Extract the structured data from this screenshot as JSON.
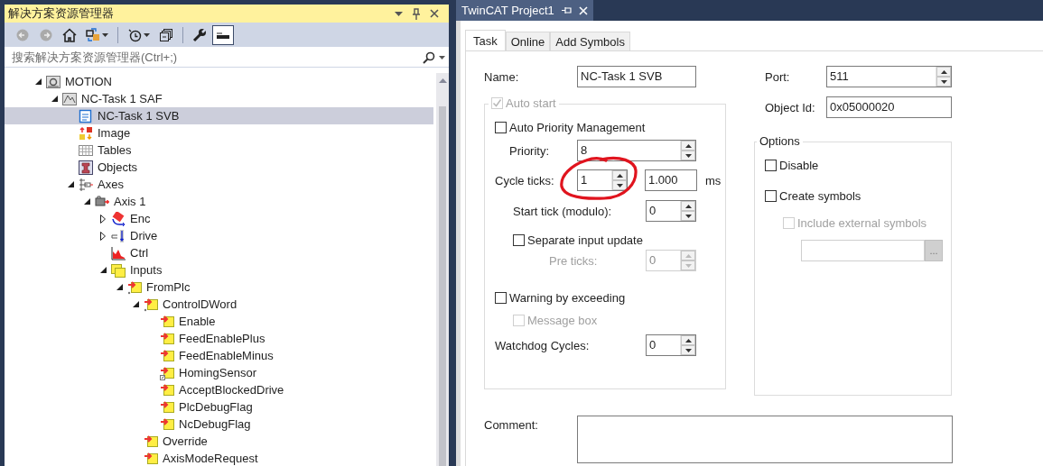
{
  "explorer": {
    "title": "解决方案资源管理器",
    "toolbar": [
      {
        "kind": "back",
        "disabled": true,
        "pressed": false
      },
      {
        "kind": "forward",
        "disabled": true,
        "pressed": false
      },
      {
        "kind": "home",
        "disabled": false,
        "pressed": false
      },
      {
        "kind": "sync",
        "disabled": false,
        "pressed": false
      },
      {
        "kind": "history",
        "disabled": false,
        "pressed": false
      },
      {
        "kind": "collapse",
        "disabled": false,
        "pressed": false
      },
      {
        "kind": "properties",
        "disabled": false,
        "pressed": false
      },
      {
        "kind": "preview",
        "disabled": false,
        "pressed": true
      }
    ],
    "search": {
      "placeholder": "搜索解决方案资源管理器(Ctrl+;)"
    },
    "tree": [
      {
        "label": "MOTION",
        "kind": "motion",
        "selected": false,
        "expanded": true,
        "children": [
          {
            "label": "NC-Task 1 SAF",
            "kind": "task",
            "selected": false,
            "expanded": true,
            "children": [
              {
                "label": "NC-Task 1 SVB",
                "kind": "task-svb",
                "selected": true
              },
              {
                "label": "Image",
                "kind": "image",
                "selected": false
              },
              {
                "label": "Tables",
                "kind": "tables",
                "selected": false
              },
              {
                "label": "Objects",
                "kind": "objects",
                "selected": false
              },
              {
                "label": "Axes",
                "kind": "axes",
                "selected": false,
                "expanded": true,
                "children": [
                  {
                    "label": "Axis 1",
                    "kind": "axis",
                    "selected": false,
                    "expanded": true,
                    "children": [
                      {
                        "label": "Enc",
                        "kind": "enc",
                        "selected": false,
                        "expanded": false
                      },
                      {
                        "label": "Drive",
                        "kind": "drive",
                        "selected": false,
                        "expanded": false
                      },
                      {
                        "label": "Ctrl",
                        "kind": "ctrl",
                        "selected": false
                      },
                      {
                        "label": "Inputs",
                        "kind": "inputs",
                        "selected": false,
                        "expanded": true,
                        "children": [
                          {
                            "label": "FromPlc",
                            "kind": "var-struct",
                            "selected": false,
                            "expanded": true,
                            "children": [
                              {
                                "label": "ControlDWord",
                                "kind": "var-struct",
                                "selected": false,
                                "expanded": true,
                                "children": [
                                  {
                                    "label": "Enable",
                                    "kind": "var",
                                    "selected": false
                                  },
                                  {
                                    "label": "FeedEnablePlus",
                                    "kind": "var",
                                    "selected": false
                                  },
                                  {
                                    "label": "FeedEnableMinus",
                                    "kind": "var",
                                    "selected": false
                                  },
                                  {
                                    "label": "HomingSensor",
                                    "kind": "var-linked",
                                    "selected": false
                                  },
                                  {
                                    "label": "AcceptBlockedDrive",
                                    "kind": "var",
                                    "selected": false
                                  },
                                  {
                                    "label": "PlcDebugFlag",
                                    "kind": "var",
                                    "selected": false
                                  },
                                  {
                                    "label": "NcDebugFlag",
                                    "kind": "var",
                                    "selected": false
                                  }
                                ]
                              },
                              {
                                "label": "Override",
                                "kind": "var",
                                "selected": false
                              },
                              {
                                "label": "AxisModeRequest",
                                "kind": "var",
                                "selected": false
                              }
                            ]
                          }
                        ]
                      }
                    ]
                  }
                ]
              }
            ]
          }
        ]
      }
    ]
  },
  "document_tab": {
    "title": "TwinCAT Project1"
  },
  "tabs": [
    {
      "label": "Task",
      "selected": true
    },
    {
      "label": "Online",
      "selected": false
    },
    {
      "label": "Add Symbols",
      "selected": false
    }
  ],
  "form": {
    "name": {
      "label": "Name:",
      "value": "NC-Task 1 SVB"
    },
    "auto_start": {
      "label": "Auto start",
      "checked": true,
      "disabled": true
    },
    "auto_priority": {
      "label": "Auto Priority Management",
      "checked": false,
      "disabled": false
    },
    "priority": {
      "label": "Priority:",
      "value": "8",
      "disabled": false
    },
    "cycle_ticks": {
      "label": "Cycle ticks:",
      "value": "1",
      "disabled": false,
      "time_value": "1.000",
      "unit": "ms"
    },
    "start_tick": {
      "label": "Start tick (modulo):",
      "value": "0",
      "disabled": false
    },
    "separate_input_update": {
      "label": "Separate input update",
      "checked": false,
      "disabled": false
    },
    "pre_ticks": {
      "label": "Pre ticks:",
      "value": "0",
      "disabled": true
    },
    "warning_by_exceeding": {
      "label": "Warning by exceeding",
      "checked": false,
      "disabled": false
    },
    "message_box": {
      "label": "Message box",
      "checked": false,
      "disabled": true
    },
    "watchdog_cycles": {
      "label": "Watchdog Cycles:",
      "value": "0",
      "disabled": false
    },
    "comment": {
      "label": "Comment:"
    },
    "port": {
      "label": "Port:",
      "value": "511",
      "disabled": false
    },
    "object_id": {
      "label": "Object Id:",
      "value": "0x05000020"
    },
    "options": {
      "title": "Options",
      "disable": {
        "label": "Disable",
        "checked": false,
        "disabled": false
      },
      "create_symbols": {
        "label": "Create symbols",
        "checked": false,
        "disabled": false
      },
      "include_external_symbols": {
        "label": "Include external symbols",
        "checked": false,
        "disabled": true
      },
      "path_field": {
        "disabled": true
      },
      "browse_button": {
        "label": "...",
        "disabled": true
      }
    }
  }
}
